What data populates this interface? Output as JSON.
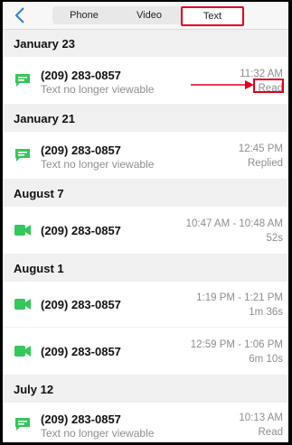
{
  "tabs": [
    "Phone",
    "Video",
    "Text"
  ],
  "active_tab": "Text",
  "sections": [
    {
      "label": "January 23",
      "rows": [
        {
          "icon": "message-icon",
          "number": "(209) 283-0857",
          "sub": "Text no longer viewable",
          "right1": "11:32 AM",
          "right2": "Read"
        }
      ]
    },
    {
      "label": "January 21",
      "rows": [
        {
          "icon": "message-icon",
          "number": "(209) 283-0857",
          "sub": "Text no longer viewable",
          "right1": "12:45 PM",
          "right2": "Replied"
        }
      ]
    },
    {
      "label": "August 7",
      "rows": [
        {
          "icon": "video-icon",
          "number": "(209) 283-0857",
          "sub": "",
          "right1": "10:47 AM - 10:48 AM",
          "right2": "52s"
        }
      ]
    },
    {
      "label": "August 1",
      "rows": [
        {
          "icon": "video-icon",
          "number": "(209) 283-0857",
          "sub": "",
          "right1": "1:19 PM - 1:21 PM",
          "right2": "1m 36s"
        },
        {
          "icon": "video-icon",
          "number": "(209) 283-0857",
          "sub": "",
          "right1": "12:59 PM - 1:06 PM",
          "right2": "6m 10s"
        }
      ]
    },
    {
      "label": "July 12",
      "rows": [
        {
          "icon": "message-icon",
          "number": "(209) 283-0857",
          "sub": "Text no longer viewable",
          "right1": "10:13 AM",
          "right2": "Read"
        }
      ]
    }
  ],
  "colors": {
    "accent": "#2a7fd4",
    "icon_green": "#34c759",
    "highlight_red": "#e0001a"
  }
}
